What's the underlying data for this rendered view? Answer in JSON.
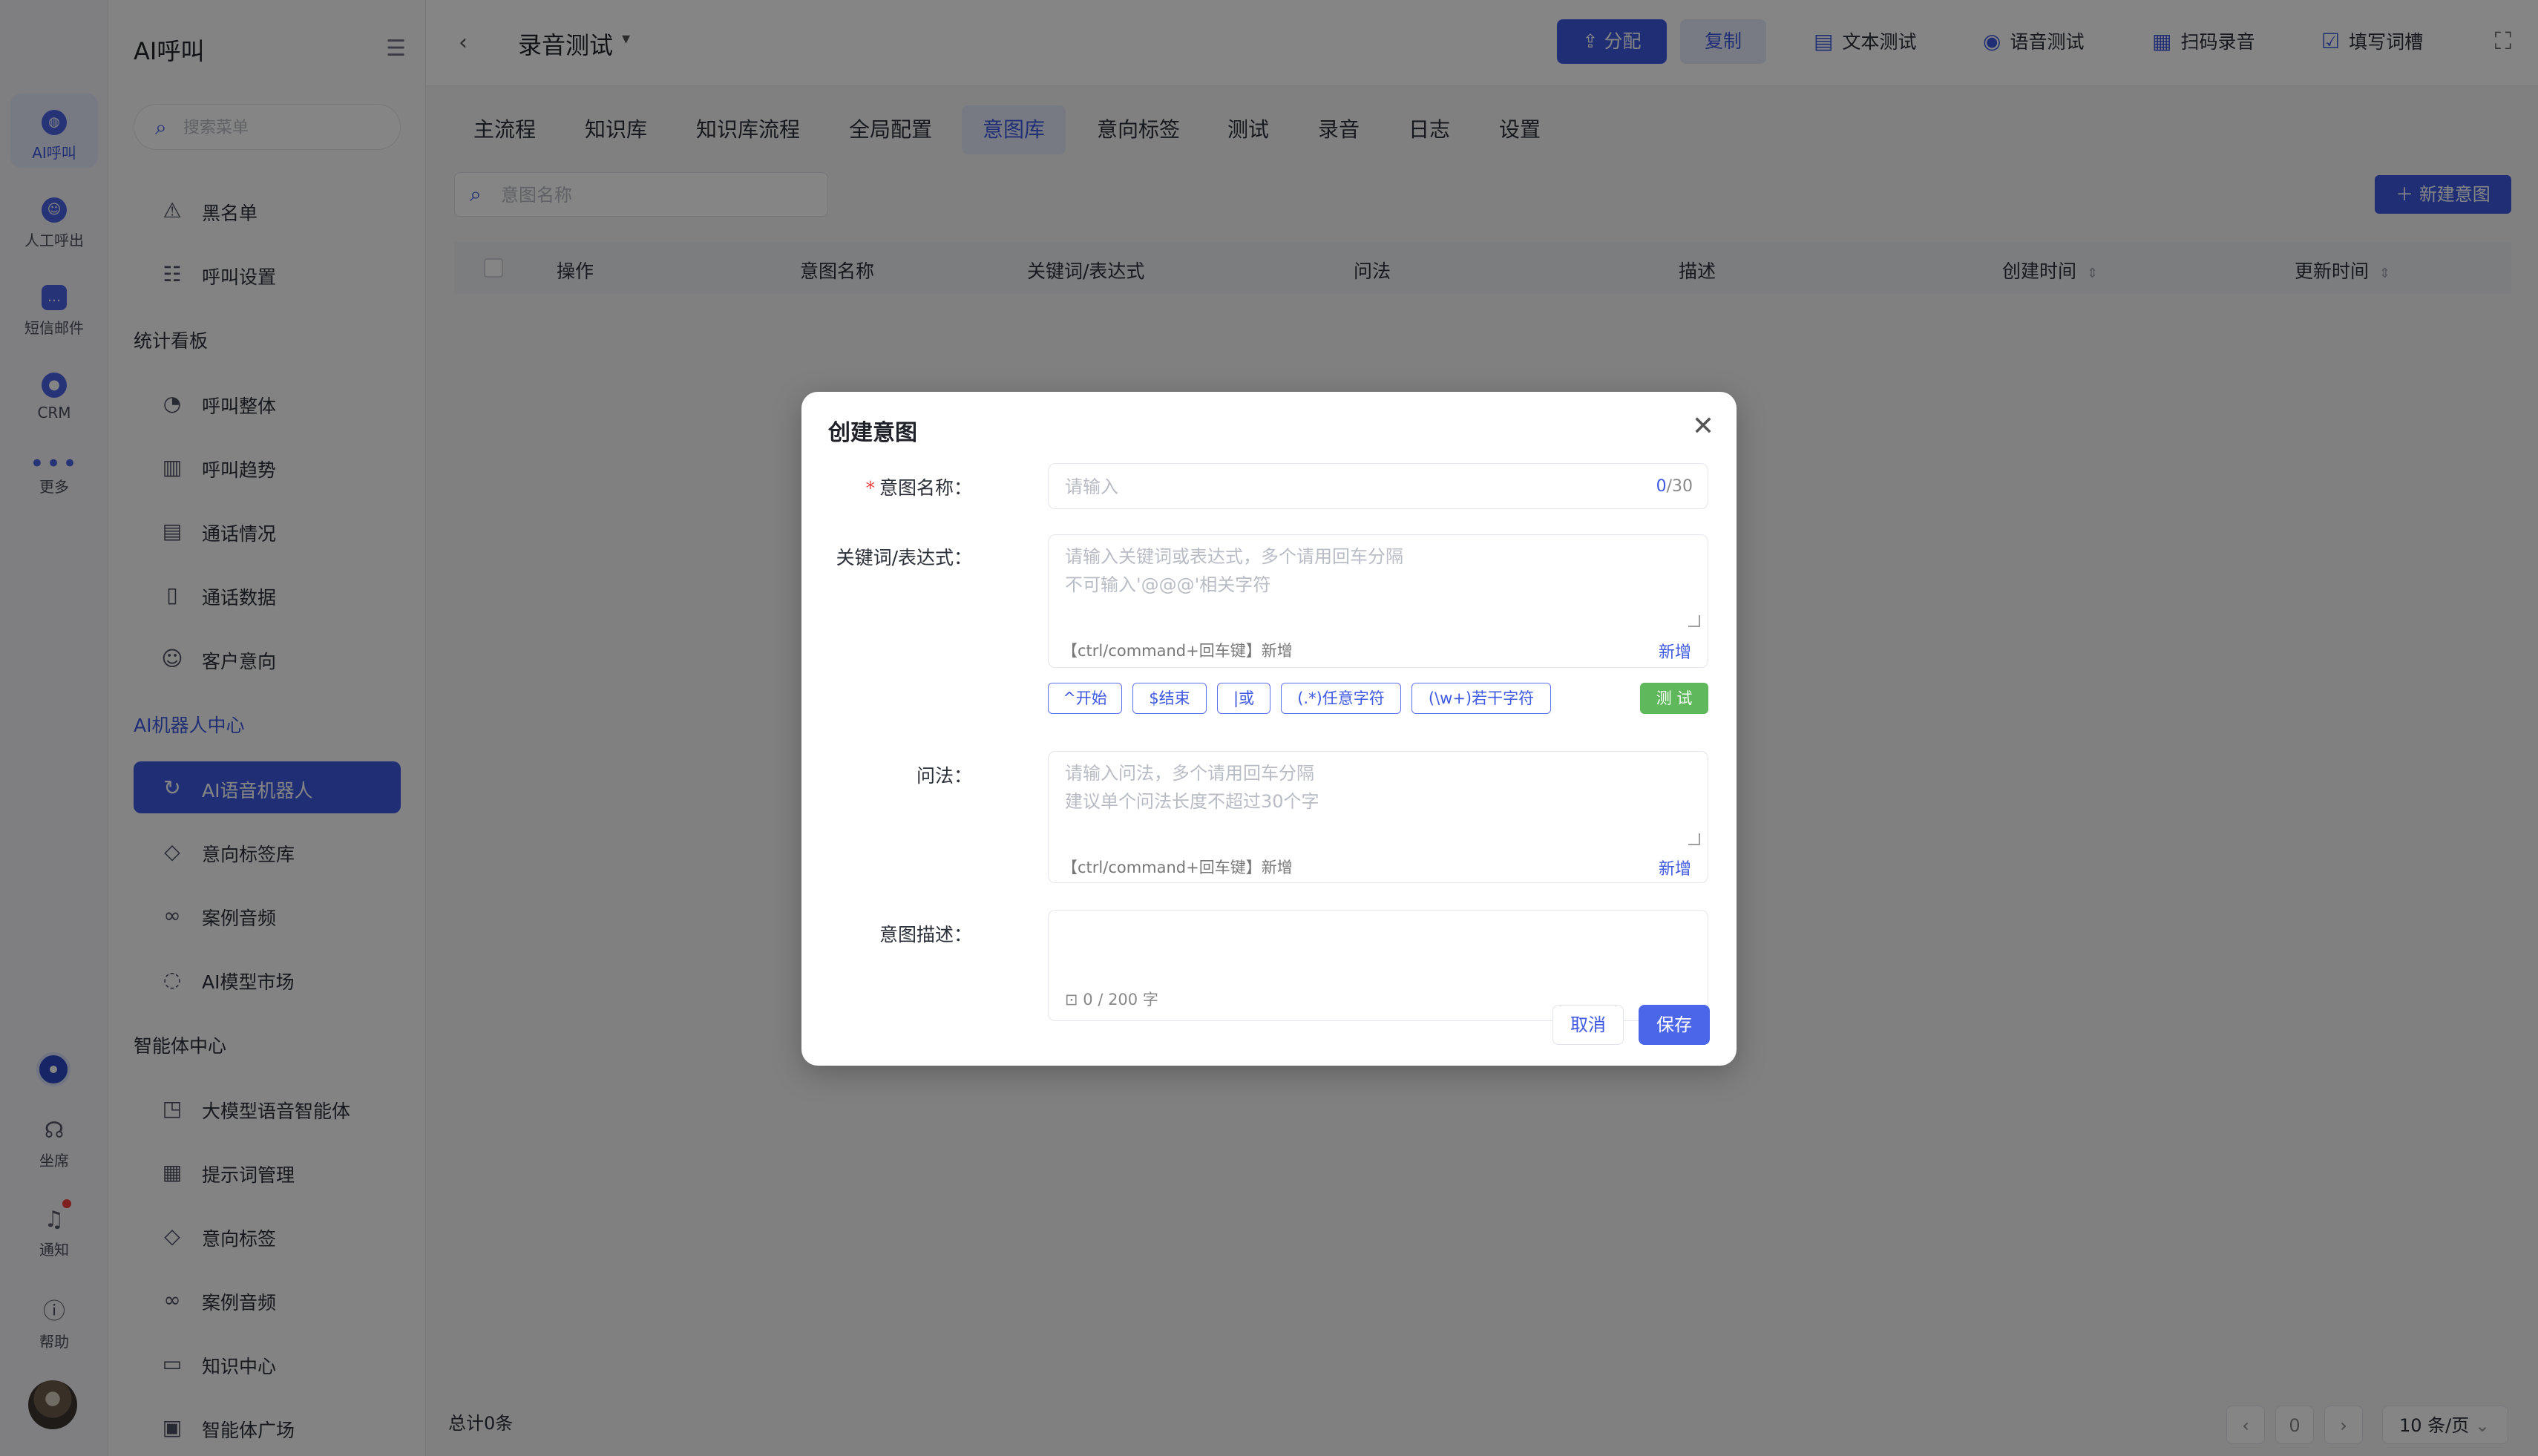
{
  "rail": {
    "items": [
      {
        "label": "AI呼叫",
        "icon": "ai-call-icon"
      },
      {
        "label": "人工呼出",
        "icon": "headset-icon"
      },
      {
        "label": "短信邮件",
        "icon": "message-icon"
      },
      {
        "label": "CRM",
        "icon": "crm-icon"
      },
      {
        "label": "更多",
        "icon": "more-icon"
      }
    ],
    "bottom": [
      {
        "label": "坐席",
        "icon": "agent-icon"
      },
      {
        "label": "通知",
        "icon": "bell-icon"
      },
      {
        "label": "帮助",
        "icon": "help-icon"
      }
    ]
  },
  "sidebar": {
    "brand": "AI呼叫",
    "search_placeholder": "搜索菜单",
    "group1": [
      {
        "label": "黑名单",
        "icon": "warning-icon"
      },
      {
        "label": "呼叫设置",
        "icon": "sliders-icon"
      }
    ],
    "section_stats": "统计看板",
    "stats": [
      {
        "label": "呼叫整体",
        "icon": "pie-chart-icon"
      },
      {
        "label": "呼叫趋势",
        "icon": "bar-chart-icon"
      },
      {
        "label": "通话情况",
        "icon": "document-icon"
      },
      {
        "label": "通话数据",
        "icon": "file-search-icon"
      },
      {
        "label": "客户意向",
        "icon": "smile-icon"
      }
    ],
    "section_ai": "AI机器人中心",
    "ai": [
      {
        "label": "AI语音机器人",
        "icon": "robot-icon"
      },
      {
        "label": "意向标签库",
        "icon": "tag-icon"
      },
      {
        "label": "案例音频",
        "icon": "voicemail-icon"
      },
      {
        "label": "AI模型市场",
        "icon": "chat-icon"
      }
    ],
    "section_agent": "智能体中心",
    "agent": [
      {
        "label": "大模型语音智能体",
        "icon": "model-icon"
      },
      {
        "label": "提示词管理",
        "icon": "list-icon"
      },
      {
        "label": "意向标签",
        "icon": "tag-icon"
      },
      {
        "label": "案例音频",
        "icon": "voicemail-icon"
      },
      {
        "label": "知识中心",
        "icon": "book-icon"
      },
      {
        "label": "智能体广场",
        "icon": "store-icon"
      }
    ]
  },
  "topbar": {
    "title": "录音测试",
    "assign": "分配",
    "copy": "复制",
    "text_test": "文本测试",
    "voice_test": "语音测试",
    "scan_record": "扫码录音",
    "fill_slots": "填写词槽"
  },
  "tabs": [
    "主流程",
    "知识库",
    "知识库流程",
    "全局配置",
    "意图库",
    "意向标签",
    "测试",
    "录音",
    "日志",
    "设置"
  ],
  "content": {
    "search_placeholder": "意图名称",
    "new_button": "新建意图",
    "columns": [
      "操作",
      "意图名称",
      "关键词/表达式",
      "问法",
      "描述",
      "创建时间",
      "更新时间"
    ],
    "total": "总计0条",
    "page_number": "0",
    "page_size": "10 条/页"
  },
  "modal": {
    "title": "创建意图",
    "name_label": "意图名称：",
    "name_placeholder": "请输入",
    "name_count": "0",
    "name_max": "/30",
    "keyword_label": "关键词/表达式：",
    "keyword_placeholder": "请输入关键词或表达式，多个请用回车分隔\n不可输入'@@@'相关字符",
    "keyword_hint": "【ctrl/command+回车键】新增",
    "keyword_add": "新增",
    "chips": [
      "^开始",
      "$结束",
      "|或",
      "(.*)任意字符",
      "(\\w+)若干字符"
    ],
    "test_button": "测 试",
    "question_label": "问法：",
    "question_placeholder": "请输入问法，多个请用回车分隔\n建议单个问法长度不超过30个字",
    "question_hint": "【ctrl/command+回车键】新增",
    "question_add": "新增",
    "desc_label": "意图描述：",
    "desc_counter": "0 / 200 字",
    "cancel": "取消",
    "save": "保存"
  },
  "colors": {
    "primary": "#3f5ae0",
    "success": "#5fb85c",
    "danger": "#f04444"
  }
}
